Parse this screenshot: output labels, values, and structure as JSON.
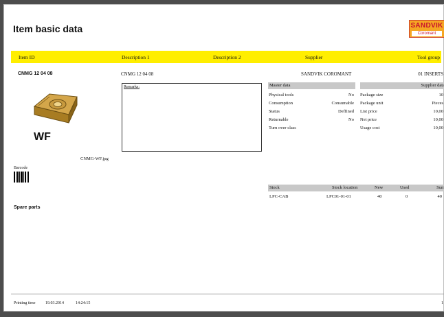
{
  "document": {
    "title": "Item basic data",
    "logo": {
      "line1": "SANDVIK",
      "line2": "Coromant",
      "color": "#f5a623"
    },
    "header_band": {
      "color": "#ffee00",
      "item_id": "Item ID",
      "description1": "Description 1",
      "description2": "Description 2",
      "supplier": "Supplier",
      "tool_group": "Tool group"
    },
    "item": {
      "id": "CNMG 12 04 08",
      "description1": "CNMG 12 04 08",
      "supplier": "SANDVIK COROMANT",
      "tool_group": "01 INSERTS",
      "image_label": "WF",
      "image_caption": "CNMG-WF.jpg"
    },
    "remarks_label": "Remarks:",
    "master_data": {
      "header": "Master data",
      "rows": [
        {
          "label": "Physical tools",
          "value": "No"
        },
        {
          "label": "Consumption",
          "value": "Consumable"
        },
        {
          "label": "Status",
          "value": "Deffined"
        },
        {
          "label": "Returnable",
          "value": "No"
        },
        {
          "label": "Turn over class",
          "value": ""
        }
      ]
    },
    "supplier_data": {
      "header": "Supplier data",
      "rows": [
        {
          "label": "Package size",
          "value": "10"
        },
        {
          "label": "Package unit",
          "value": "Pieces"
        },
        {
          "label": "List price",
          "value": "10,00"
        },
        {
          "label": "Net price",
          "value": "10,00"
        },
        {
          "label": "Usage cost",
          "value": "10,00"
        }
      ]
    },
    "barcode_label": "Barcode",
    "stock": {
      "columns": [
        "Stock",
        "Stock location",
        "New",
        "Used",
        "Sum"
      ],
      "rows": [
        [
          "LPC-CAB",
          "LPC01-01-01",
          "40",
          "0",
          "40"
        ]
      ]
    },
    "spare_parts_label": "Spare parts",
    "footer": {
      "printing_time_label": "Printing time",
      "date": "19.03.2014",
      "time": "14:24:15",
      "page_number": "1"
    }
  }
}
